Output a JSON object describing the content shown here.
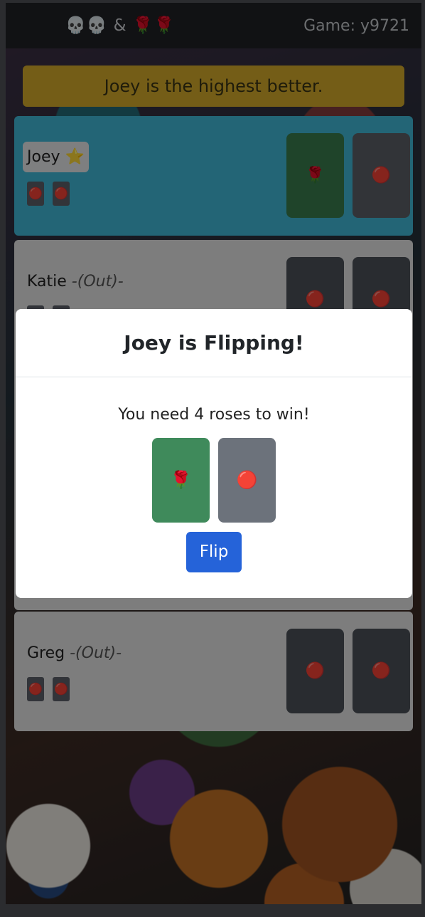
{
  "navbar": {
    "brand": "💀💀 & 🌹🌹",
    "game_id": "Game: y9721"
  },
  "alert": {
    "text": "Joey is the highest better."
  },
  "players": [
    {
      "name": "Joey ⭐",
      "status": "",
      "mini_cards": [
        "🔴",
        "🔴"
      ],
      "cards": [
        {
          "face": "🌹",
          "color": "green"
        },
        {
          "face": "🔴",
          "color": "grey"
        }
      ]
    },
    {
      "name": "Katie",
      "status": "-(Out)-",
      "mini_cards": [
        "",
        ""
      ],
      "cards": [
        {
          "face": "🔴",
          "color": "grey"
        },
        {
          "face": "🔴",
          "color": "grey"
        }
      ]
    },
    {
      "name": "Greg",
      "status": "-(Out)-",
      "mini_cards": [
        "🔴",
        "🔴"
      ],
      "cards": [
        {
          "face": "🔴",
          "color": "grey"
        },
        {
          "face": "🔴",
          "color": "grey"
        }
      ]
    }
  ],
  "modal": {
    "title": "Joey is Flipping!",
    "message": "You need 4 roses to win!",
    "cards": [
      {
        "face": "🌹",
        "color": "green"
      },
      {
        "face": "🔴",
        "color": "grey"
      }
    ],
    "flip_label": "Flip"
  },
  "colors": {
    "active_player": "#40b8d8",
    "alert": "#d4aa2b",
    "rose_card": "#3f8a5b",
    "skull_card": "#6c727b",
    "primary_button": "#2563d9"
  }
}
